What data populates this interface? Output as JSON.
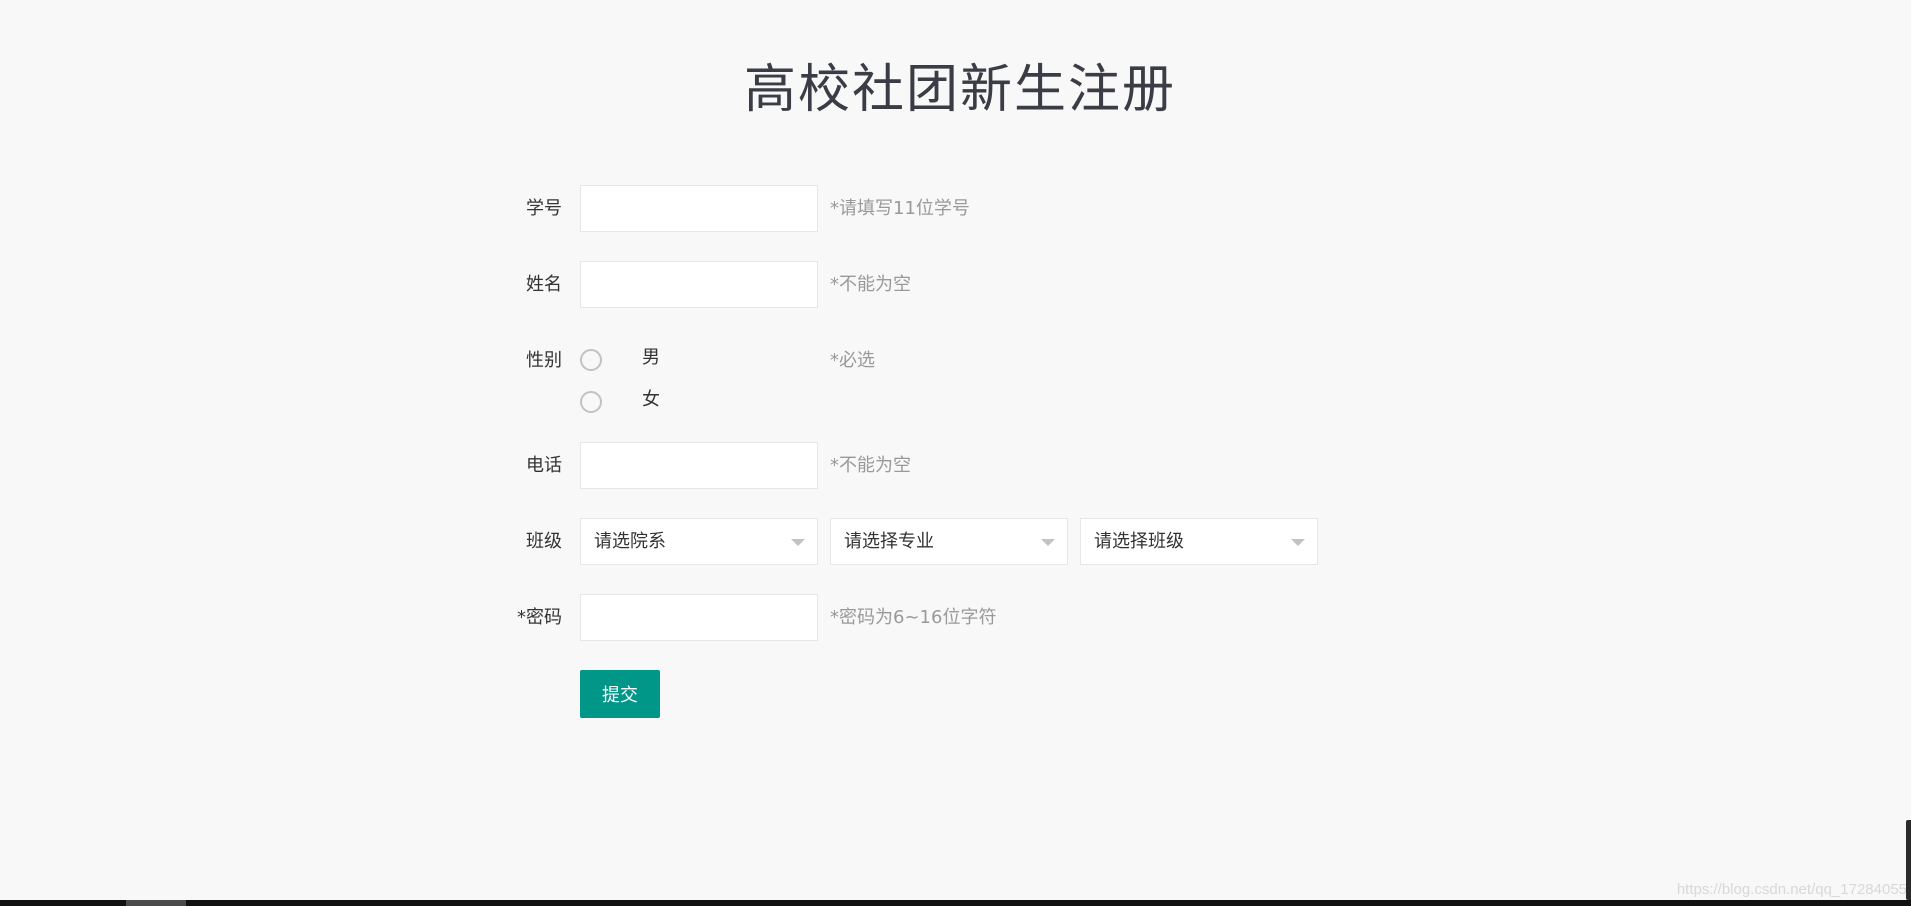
{
  "page": {
    "title": "高校社团新生注册"
  },
  "form": {
    "student_id": {
      "label": "学号",
      "value": "",
      "hint": "*请填写11位学号"
    },
    "name": {
      "label": "姓名",
      "value": "",
      "hint": "*不能为空"
    },
    "gender": {
      "label": "性别",
      "options": [
        "男",
        "女"
      ],
      "hint": "*必选"
    },
    "phone": {
      "label": "电话",
      "value": "",
      "hint": "*不能为空"
    },
    "class": {
      "label": "班级",
      "department_select": "请选院系",
      "major_select": "请选择专业",
      "class_select": "请选择班级"
    },
    "password": {
      "label": "*密码",
      "value": "",
      "hint": "*密码为6~16位字符"
    },
    "submit_label": "提交"
  },
  "watermark": "https://blog.csdn.net/qq_17284055",
  "colors": {
    "accent": "#009688",
    "background": "#f8f8f8",
    "hint": "#999999",
    "border": "#e6e6e6"
  }
}
